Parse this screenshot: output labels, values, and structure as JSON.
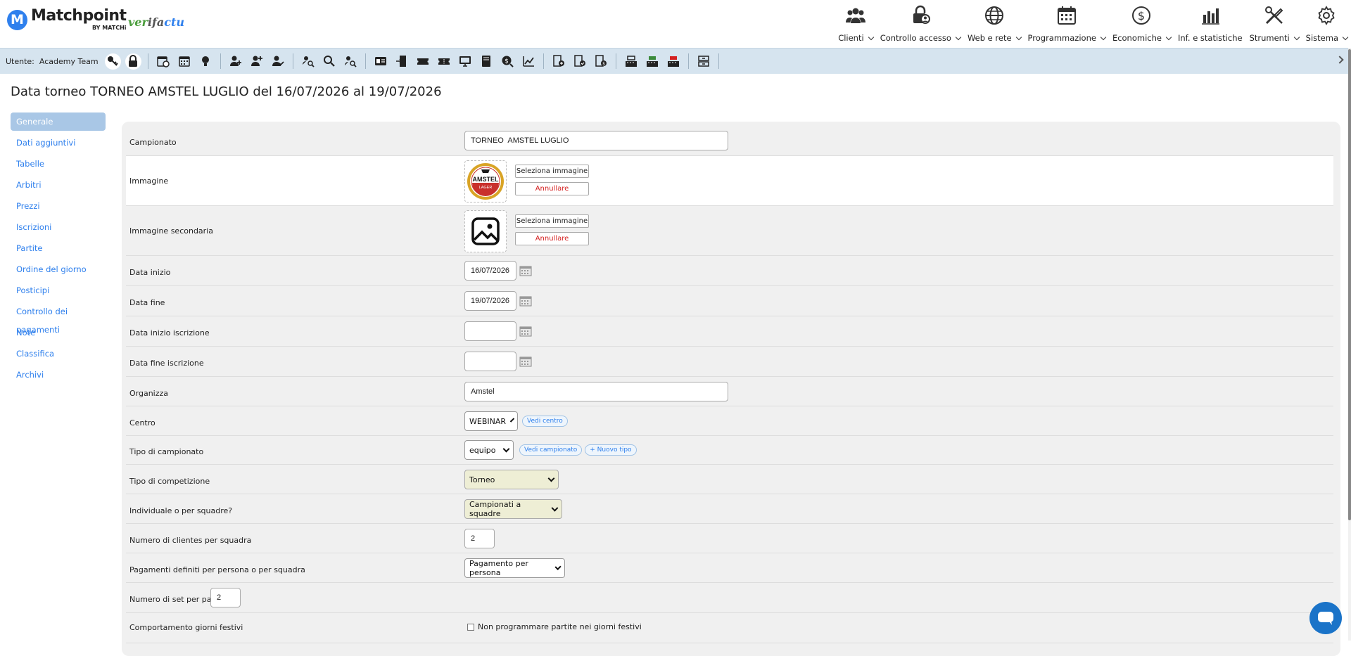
{
  "brand": {
    "name": "Matchpoint",
    "by": "BY MATCHi",
    "logo_letter": "M",
    "partner_part1": "ver",
    "partner_part2": "ifa",
    "partner_part3": "ctu"
  },
  "mainnav": [
    {
      "label": "Clienti",
      "icon": "people-icon"
    },
    {
      "label": "Controllo accesso",
      "icon": "lock-user-icon"
    },
    {
      "label": "Web e rete",
      "icon": "globe-icon"
    },
    {
      "label": "Programmazione",
      "icon": "calendar-icon"
    },
    {
      "label": "Economiche",
      "icon": "dollar-icon"
    },
    {
      "label": "Inf. e statistiche",
      "icon": "bar-chart-icon"
    },
    {
      "label": "Strumenti",
      "icon": "tools-icon"
    },
    {
      "label": "Sistema",
      "icon": "gear-icon"
    }
  ],
  "toolbar": {
    "user_label": "Utente:",
    "user_name": "Academy Team"
  },
  "page_title": "Data torneo TORNEO AMSTEL LUGLIO del 16/07/2026 al 19/07/2026",
  "sidebar": {
    "items": [
      "Generale",
      "Dati aggiuntivi",
      "Tabelle",
      "Arbitri",
      "Prezzi",
      "Iscrizioni",
      "Partite",
      "Ordine del giorno",
      "Posticipi",
      "Controllo dei pagamenti",
      "Note",
      "Classifica",
      "Archivi"
    ]
  },
  "form": {
    "campionato": {
      "label": "Campionato",
      "value": "TORNEO  AMSTEL LUGLIO"
    },
    "immagine": {
      "label": "Immagine",
      "select_label": "Seleziona immagine",
      "cancel_label": "Annullare",
      "logo_top": "AMSTEL",
      "logo_bottom": "LAGER"
    },
    "immagine_secondaria": {
      "label": "Immagine secondaria",
      "select_label": "Seleziona immagine",
      "cancel_label": "Annullare"
    },
    "data_inizio": {
      "label": "Data inizio",
      "value": "16/07/2026"
    },
    "data_fine": {
      "label": "Data fine",
      "value": "19/07/2026"
    },
    "data_inizio_iscrizione": {
      "label": "Data inizio iscrizione",
      "value": ""
    },
    "data_fine_iscrizione": {
      "label": "Data fine iscrizione",
      "value": ""
    },
    "organizza": {
      "label": "Organizza",
      "value": "Amstel"
    },
    "centro": {
      "label": "Centro",
      "value": "WEBINAR",
      "link": "Vedi centro"
    },
    "tipo_campionato": {
      "label": "Tipo di campionato",
      "value": "equipo",
      "link1": "Vedi campionato",
      "link2": "+ Nuovo tipo"
    },
    "tipo_competizione": {
      "label": "Tipo di competizione",
      "value": "Torneo"
    },
    "individuale": {
      "label": "Individuale o per squadre?",
      "value": "Campionati a squadre"
    },
    "numero_clientes": {
      "label": "Numero di clientes per squadra",
      "value": "2"
    },
    "pagamenti": {
      "label": "Pagamenti definiti per persona o per squadra",
      "value": "Pagamento per persona"
    },
    "numero_set": {
      "label": "Numero di set per partita",
      "value": "2"
    },
    "giorni_festivi": {
      "label": "Comportamento giorni festivi",
      "checkbox_label": "Non programmare partite nei giorni festivi"
    }
  },
  "colors": {
    "accent": "#2f80ed",
    "toolbar_bg": "#d6e4ef",
    "danger": "#d42020",
    "form_bg": "#f0f0f0"
  }
}
